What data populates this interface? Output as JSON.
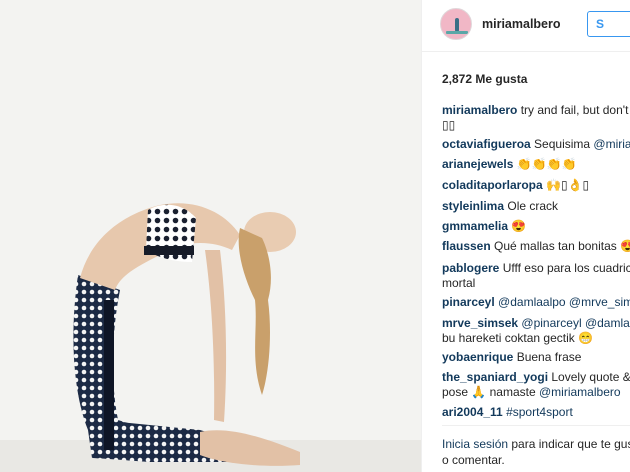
{
  "post": {
    "photo_alt": "yoga",
    "author": {
      "username": "miriamalbero",
      "follow_label": "S"
    },
    "likes_label": "2,872 Me gusta",
    "comments": [
      {
        "user": "miriamalbero",
        "text": "try and fail, but don't f",
        "cont": "▯▯"
      },
      {
        "user": "octaviafigueroa",
        "text": "Sequisima ",
        "mention": "@miriam"
      },
      {
        "user": "arianejewels",
        "text": "👏👏👏👏"
      },
      {
        "user": "coladitaporlaropa",
        "text": "🙌▯👌▯"
      },
      {
        "user": "styleinlima",
        "text": "Ole crack"
      },
      {
        "user": "gmmamelia",
        "text": "😍"
      },
      {
        "user": "flaussen",
        "text": "Qué mallas tan bonitas 😍"
      },
      {
        "user": "pablogere",
        "text": "Ufff eso para los cuadric",
        "cont": "mortal"
      },
      {
        "user": "pinarceyl",
        "text": "",
        "mention": "@damlaalpo @mrve_sims"
      },
      {
        "user": "mrve_simsek",
        "text": "",
        "mention": "@pinarceyl @damlaalp",
        "cont": "bu hareketi coktan gectik 😁"
      },
      {
        "user": "yobaenrique",
        "text": "Buena frase"
      },
      {
        "user": "the_spaniard_yogi",
        "text": "Lovely quote & ",
        "cont": "pose 🙏 namaste ",
        "cont_mention": "@miriamalbero"
      },
      {
        "user": "ari2004_11",
        "text": "",
        "mention": "#sport4sport"
      }
    ],
    "login_link": "Inicia sesión",
    "login_text": " para indicar que te gus",
    "login_cont": "o comentar."
  },
  "colors": {
    "link": "#12395b",
    "accent": "#3897f0",
    "background": "#f3f3f1"
  }
}
